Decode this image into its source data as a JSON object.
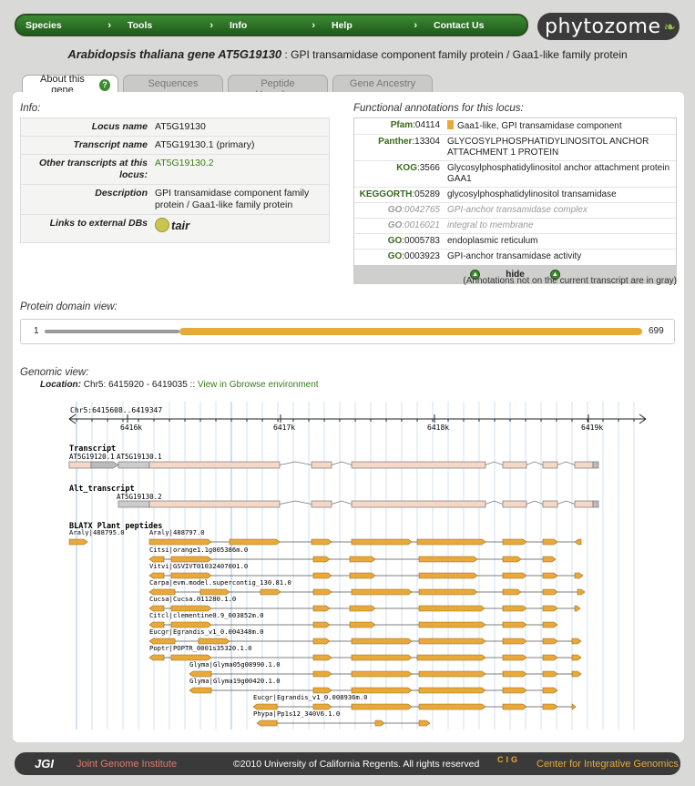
{
  "nav": {
    "items": [
      "Species",
      "Tools",
      "Info",
      "Help",
      "Contact Us"
    ],
    "logo": "phytozome"
  },
  "title": {
    "species": "Arabidopsis thaliana",
    "gene_prefix": "gene",
    "gene": "AT5G19130",
    "description": ": GPI transamidase component family protein / Gaa1-like family protein"
  },
  "tabs": [
    "About this gene",
    "Sequences",
    "Peptide Homologs",
    "Gene Ancestry"
  ],
  "info": {
    "title": "Info:",
    "rows": [
      {
        "key": "Locus name",
        "value": "AT5G19130"
      },
      {
        "key": "Transcript name",
        "value": "AT5G19130.1 (primary)"
      },
      {
        "key": "Other transcripts at this locus:",
        "value": "AT5G19130.2"
      },
      {
        "key": "Description",
        "value": "GPI transamidase component family protein / Gaa1-like family protein"
      },
      {
        "key": "Links to external DBs",
        "value": "tair"
      }
    ]
  },
  "annotations": {
    "title": "Functional annotations for this locus:",
    "rows": [
      {
        "db": "Pfam",
        "id": ":04114",
        "text": "Gaa1-like, GPI transamidase component",
        "gray": false,
        "marker": true
      },
      {
        "db": "Panther",
        "id": ":13304",
        "text": "GLYCOSYLPHOSPHATIDYLINOSITOL ANCHOR ATTACHMENT 1 PROTEIN",
        "gray": false
      },
      {
        "db": "KOG",
        "id": ":3566",
        "text": "Glycosylphosphatidylinositol anchor attachment protein GAA1",
        "gray": false
      },
      {
        "db": "KEGGORTH",
        "id": ":05289",
        "text": "glycosylphosphatidylinositol transamidase",
        "gray": false
      },
      {
        "db": "GO",
        "id": ":0042765",
        "text": "GPI-anchor transamidase complex",
        "gray": true
      },
      {
        "db": "GO",
        "id": ":0016021",
        "text": "integral to membrane",
        "gray": true
      },
      {
        "db": "GO",
        "id": ":0005783",
        "text": "endoplasmic reticulum",
        "gray": false
      },
      {
        "db": "GO",
        "id": ":0003923",
        "text": "GPI-anchor transamidase activity",
        "gray": false
      }
    ],
    "hide_label": "hide",
    "note": "(Annotations not on the current transcript are in gray)"
  },
  "protein_domain": {
    "title": "Protein domain view:",
    "start": "1",
    "end": "699"
  },
  "genomic": {
    "title": "Genomic view:",
    "location_label": "Location:",
    "location": "Chr5: 6415920 - 6419035 ::",
    "gbrowse_link": "View in Gbrowse environment",
    "range_label": "Chr5:6415608..6419347",
    "ticks": [
      "6416k",
      "6417k",
      "6418k",
      "6419k"
    ],
    "transcript_track": "Transcript",
    "transcript_labels": [
      "AT5G19120.1",
      "AT5G19130.1"
    ],
    "alt_track": "Alt_transcript",
    "alt_label": "AT5G19130.2",
    "blatx_track": "BLATX Plant peptides",
    "peptides": [
      "Araly|488795.0",
      "Araly|488797.0",
      "Citsi|orange1.1g005386m.0",
      "Vitvi|GSVIVT01032407001.0",
      "Carpa|evm.model.supercontig_130.81.0",
      "Cucsa|Cucsa.011280.1.0",
      "Citcl|clementine0.9_003852m.0",
      "Eucgr|Egrandis_v1_0.004348m.0",
      "Poptr|POPTR_0001s35320.1.0",
      "Glyma|Glyma05g08990.1.0",
      "Glyma|Glyma19g00420.1.0",
      "Eucgr|Egrandis_v1_0.008936m.0",
      "Phypa|Pp1s12_340V6.1.0"
    ]
  },
  "footer": {
    "jgi": "JGI",
    "jgi_name": "Joint Genome Institute",
    "copyright": "©2010 University of California Regents. All rights reserved",
    "cig": "CIG",
    "cig_name": "Center for Integrative Genomics"
  }
}
